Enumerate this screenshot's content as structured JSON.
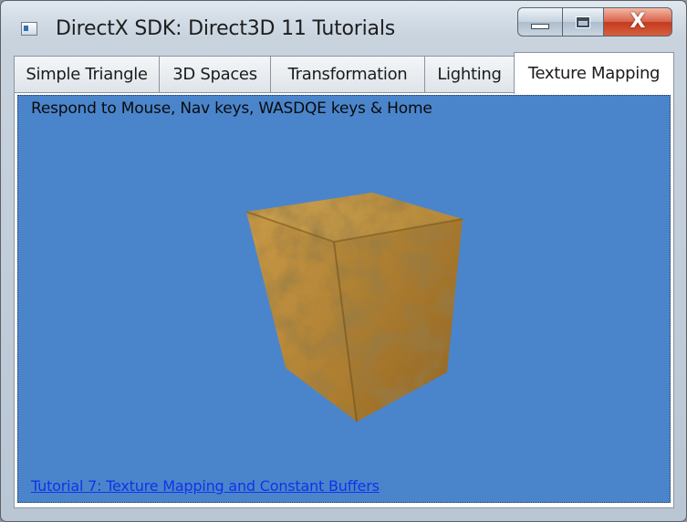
{
  "window": {
    "title": "DirectX SDK: Direct3D 11 Tutorials",
    "caption_buttons": {
      "minimize_icon": "minimize-icon",
      "maximize_icon": "maximize-icon",
      "close_glyph": "X"
    }
  },
  "tabs": [
    {
      "label": "Simple Triangle",
      "active": false
    },
    {
      "label": "3D Spaces",
      "active": false
    },
    {
      "label": "Transformation",
      "active": false
    },
    {
      "label": "Lighting",
      "active": false
    },
    {
      "label": "Texture Mapping",
      "active": true
    }
  ],
  "viewport": {
    "help_text": "Respond to Mouse, Nav keys, WASDQE keys & Home",
    "link_text": "Tutorial 7: Texture Mapping and Constant Buffers",
    "background_color": "#4a85cc",
    "object": "textured-cube"
  },
  "colors": {
    "viewport_bg": "#4a85cc",
    "link": "#1432e6",
    "close_button": "#c43a1f",
    "cube_texture": "#b98a3e"
  }
}
